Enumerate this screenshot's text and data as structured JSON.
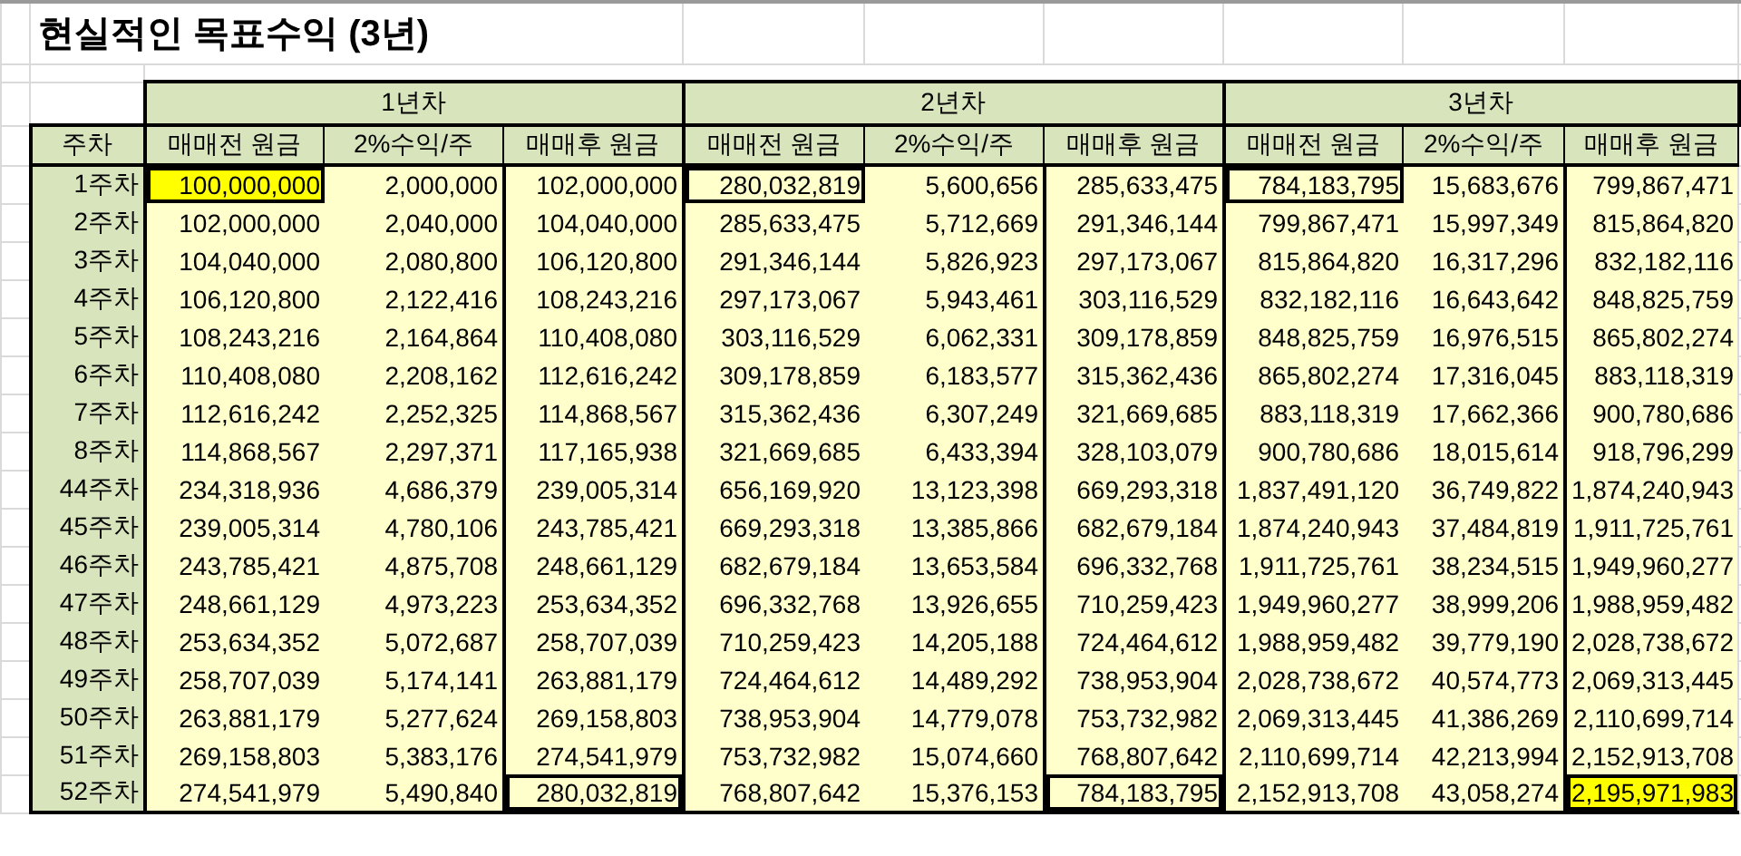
{
  "title": "현실적인 목표수익 (3년)",
  "year_groups": [
    "1년차",
    "2년차",
    "3년차"
  ],
  "columns": [
    "주차",
    "매매전 원금",
    "2%수익/주",
    "매매후 원금",
    "매매전 원금",
    "2%수익/주",
    "매매후 원금",
    "매매전 원금",
    "2%수익/주",
    "매매후 원금"
  ],
  "rows": [
    {
      "week": "1주차",
      "cells": [
        {
          "text": "100,000,000",
          "highlighted": true,
          "framed": true
        },
        {
          "text": "2,000,000",
          "highlighted": false,
          "framed": false
        },
        {
          "text": "102,000,000",
          "highlighted": false,
          "framed": false
        },
        {
          "text": "280,032,819",
          "highlighted": false,
          "framed": true
        },
        {
          "text": "5,600,656",
          "highlighted": false,
          "framed": false
        },
        {
          "text": "285,633,475",
          "highlighted": false,
          "framed": false
        },
        {
          "text": "784,183,795",
          "highlighted": false,
          "framed": true
        },
        {
          "text": "15,683,676",
          "highlighted": false,
          "framed": false
        },
        {
          "text": "799,867,471",
          "highlighted": false,
          "framed": false
        }
      ]
    },
    {
      "week": "2주차",
      "cells": [
        {
          "text": "102,000,000",
          "highlighted": false,
          "framed": false
        },
        {
          "text": "2,040,000",
          "highlighted": false,
          "framed": false
        },
        {
          "text": "104,040,000",
          "highlighted": false,
          "framed": false
        },
        {
          "text": "285,633,475",
          "highlighted": false,
          "framed": false
        },
        {
          "text": "5,712,669",
          "highlighted": false,
          "framed": false
        },
        {
          "text": "291,346,144",
          "highlighted": false,
          "framed": false
        },
        {
          "text": "799,867,471",
          "highlighted": false,
          "framed": false
        },
        {
          "text": "15,997,349",
          "highlighted": false,
          "framed": false
        },
        {
          "text": "815,864,820",
          "highlighted": false,
          "framed": false
        }
      ]
    },
    {
      "week": "3주차",
      "cells": [
        {
          "text": "104,040,000",
          "highlighted": false,
          "framed": false
        },
        {
          "text": "2,080,800",
          "highlighted": false,
          "framed": false
        },
        {
          "text": "106,120,800",
          "highlighted": false,
          "framed": false
        },
        {
          "text": "291,346,144",
          "highlighted": false,
          "framed": false
        },
        {
          "text": "5,826,923",
          "highlighted": false,
          "framed": false
        },
        {
          "text": "297,173,067",
          "highlighted": false,
          "framed": false
        },
        {
          "text": "815,864,820",
          "highlighted": false,
          "framed": false
        },
        {
          "text": "16,317,296",
          "highlighted": false,
          "framed": false
        },
        {
          "text": "832,182,116",
          "highlighted": false,
          "framed": false
        }
      ]
    },
    {
      "week": "4주차",
      "cells": [
        {
          "text": "106,120,800",
          "highlighted": false,
          "framed": false
        },
        {
          "text": "2,122,416",
          "highlighted": false,
          "framed": false
        },
        {
          "text": "108,243,216",
          "highlighted": false,
          "framed": false
        },
        {
          "text": "297,173,067",
          "highlighted": false,
          "framed": false
        },
        {
          "text": "5,943,461",
          "highlighted": false,
          "framed": false
        },
        {
          "text": "303,116,529",
          "highlighted": false,
          "framed": false
        },
        {
          "text": "832,182,116",
          "highlighted": false,
          "framed": false
        },
        {
          "text": "16,643,642",
          "highlighted": false,
          "framed": false
        },
        {
          "text": "848,825,759",
          "highlighted": false,
          "framed": false
        }
      ]
    },
    {
      "week": "5주차",
      "cells": [
        {
          "text": "108,243,216",
          "highlighted": false,
          "framed": false
        },
        {
          "text": "2,164,864",
          "highlighted": false,
          "framed": false
        },
        {
          "text": "110,408,080",
          "highlighted": false,
          "framed": false
        },
        {
          "text": "303,116,529",
          "highlighted": false,
          "framed": false
        },
        {
          "text": "6,062,331",
          "highlighted": false,
          "framed": false
        },
        {
          "text": "309,178,859",
          "highlighted": false,
          "framed": false
        },
        {
          "text": "848,825,759",
          "highlighted": false,
          "framed": false
        },
        {
          "text": "16,976,515",
          "highlighted": false,
          "framed": false
        },
        {
          "text": "865,802,274",
          "highlighted": false,
          "framed": false
        }
      ]
    },
    {
      "week": "6주차",
      "cells": [
        {
          "text": "110,408,080",
          "highlighted": false,
          "framed": false
        },
        {
          "text": "2,208,162",
          "highlighted": false,
          "framed": false
        },
        {
          "text": "112,616,242",
          "highlighted": false,
          "framed": false
        },
        {
          "text": "309,178,859",
          "highlighted": false,
          "framed": false
        },
        {
          "text": "6,183,577",
          "highlighted": false,
          "framed": false
        },
        {
          "text": "315,362,436",
          "highlighted": false,
          "framed": false
        },
        {
          "text": "865,802,274",
          "highlighted": false,
          "framed": false
        },
        {
          "text": "17,316,045",
          "highlighted": false,
          "framed": false
        },
        {
          "text": "883,118,319",
          "highlighted": false,
          "framed": false
        }
      ]
    },
    {
      "week": "7주차",
      "cells": [
        {
          "text": "112,616,242",
          "highlighted": false,
          "framed": false
        },
        {
          "text": "2,252,325",
          "highlighted": false,
          "framed": false
        },
        {
          "text": "114,868,567",
          "highlighted": false,
          "framed": false
        },
        {
          "text": "315,362,436",
          "highlighted": false,
          "framed": false
        },
        {
          "text": "6,307,249",
          "highlighted": false,
          "framed": false
        },
        {
          "text": "321,669,685",
          "highlighted": false,
          "framed": false
        },
        {
          "text": "883,118,319",
          "highlighted": false,
          "framed": false
        },
        {
          "text": "17,662,366",
          "highlighted": false,
          "framed": false
        },
        {
          "text": "900,780,686",
          "highlighted": false,
          "framed": false
        }
      ]
    },
    {
      "week": "8주차",
      "cells": [
        {
          "text": "114,868,567",
          "highlighted": false,
          "framed": false
        },
        {
          "text": "2,297,371",
          "highlighted": false,
          "framed": false
        },
        {
          "text": "117,165,938",
          "highlighted": false,
          "framed": false
        },
        {
          "text": "321,669,685",
          "highlighted": false,
          "framed": false
        },
        {
          "text": "6,433,394",
          "highlighted": false,
          "framed": false
        },
        {
          "text": "328,103,079",
          "highlighted": false,
          "framed": false
        },
        {
          "text": "900,780,686",
          "highlighted": false,
          "framed": false
        },
        {
          "text": "18,015,614",
          "highlighted": false,
          "framed": false
        },
        {
          "text": "918,796,299",
          "highlighted": false,
          "framed": false
        }
      ]
    },
    {
      "week": "44주차",
      "cells": [
        {
          "text": "234,318,936",
          "highlighted": false,
          "framed": false
        },
        {
          "text": "4,686,379",
          "highlighted": false,
          "framed": false
        },
        {
          "text": "239,005,314",
          "highlighted": false,
          "framed": false
        },
        {
          "text": "656,169,920",
          "highlighted": false,
          "framed": false
        },
        {
          "text": "13,123,398",
          "highlighted": false,
          "framed": false
        },
        {
          "text": "669,293,318",
          "highlighted": false,
          "framed": false
        },
        {
          "text": "1,837,491,120",
          "highlighted": false,
          "framed": false
        },
        {
          "text": "36,749,822",
          "highlighted": false,
          "framed": false
        },
        {
          "text": "1,874,240,943",
          "highlighted": false,
          "framed": false
        }
      ]
    },
    {
      "week": "45주차",
      "cells": [
        {
          "text": "239,005,314",
          "highlighted": false,
          "framed": false
        },
        {
          "text": "4,780,106",
          "highlighted": false,
          "framed": false
        },
        {
          "text": "243,785,421",
          "highlighted": false,
          "framed": false
        },
        {
          "text": "669,293,318",
          "highlighted": false,
          "framed": false
        },
        {
          "text": "13,385,866",
          "highlighted": false,
          "framed": false
        },
        {
          "text": "682,679,184",
          "highlighted": false,
          "framed": false
        },
        {
          "text": "1,874,240,943",
          "highlighted": false,
          "framed": false
        },
        {
          "text": "37,484,819",
          "highlighted": false,
          "framed": false
        },
        {
          "text": "1,911,725,761",
          "highlighted": false,
          "framed": false
        }
      ]
    },
    {
      "week": "46주차",
      "cells": [
        {
          "text": "243,785,421",
          "highlighted": false,
          "framed": false
        },
        {
          "text": "4,875,708",
          "highlighted": false,
          "framed": false
        },
        {
          "text": "248,661,129",
          "highlighted": false,
          "framed": false
        },
        {
          "text": "682,679,184",
          "highlighted": false,
          "framed": false
        },
        {
          "text": "13,653,584",
          "highlighted": false,
          "framed": false
        },
        {
          "text": "696,332,768",
          "highlighted": false,
          "framed": false
        },
        {
          "text": "1,911,725,761",
          "highlighted": false,
          "framed": false
        },
        {
          "text": "38,234,515",
          "highlighted": false,
          "framed": false
        },
        {
          "text": "1,949,960,277",
          "highlighted": false,
          "framed": false
        }
      ]
    },
    {
      "week": "47주차",
      "cells": [
        {
          "text": "248,661,129",
          "highlighted": false,
          "framed": false
        },
        {
          "text": "4,973,223",
          "highlighted": false,
          "framed": false
        },
        {
          "text": "253,634,352",
          "highlighted": false,
          "framed": false
        },
        {
          "text": "696,332,768",
          "highlighted": false,
          "framed": false
        },
        {
          "text": "13,926,655",
          "highlighted": false,
          "framed": false
        },
        {
          "text": "710,259,423",
          "highlighted": false,
          "framed": false
        },
        {
          "text": "1,949,960,277",
          "highlighted": false,
          "framed": false
        },
        {
          "text": "38,999,206",
          "highlighted": false,
          "framed": false
        },
        {
          "text": "1,988,959,482",
          "highlighted": false,
          "framed": false
        }
      ]
    },
    {
      "week": "48주차",
      "cells": [
        {
          "text": "253,634,352",
          "highlighted": false,
          "framed": false
        },
        {
          "text": "5,072,687",
          "highlighted": false,
          "framed": false
        },
        {
          "text": "258,707,039",
          "highlighted": false,
          "framed": false
        },
        {
          "text": "710,259,423",
          "highlighted": false,
          "framed": false
        },
        {
          "text": "14,205,188",
          "highlighted": false,
          "framed": false
        },
        {
          "text": "724,464,612",
          "highlighted": false,
          "framed": false
        },
        {
          "text": "1,988,959,482",
          "highlighted": false,
          "framed": false
        },
        {
          "text": "39,779,190",
          "highlighted": false,
          "framed": false
        },
        {
          "text": "2,028,738,672",
          "highlighted": false,
          "framed": false
        }
      ]
    },
    {
      "week": "49주차",
      "cells": [
        {
          "text": "258,707,039",
          "highlighted": false,
          "framed": false
        },
        {
          "text": "5,174,141",
          "highlighted": false,
          "framed": false
        },
        {
          "text": "263,881,179",
          "highlighted": false,
          "framed": false
        },
        {
          "text": "724,464,612",
          "highlighted": false,
          "framed": false
        },
        {
          "text": "14,489,292",
          "highlighted": false,
          "framed": false
        },
        {
          "text": "738,953,904",
          "highlighted": false,
          "framed": false
        },
        {
          "text": "2,028,738,672",
          "highlighted": false,
          "framed": false
        },
        {
          "text": "40,574,773",
          "highlighted": false,
          "framed": false
        },
        {
          "text": "2,069,313,445",
          "highlighted": false,
          "framed": false
        }
      ]
    },
    {
      "week": "50주차",
      "cells": [
        {
          "text": "263,881,179",
          "highlighted": false,
          "framed": false
        },
        {
          "text": "5,277,624",
          "highlighted": false,
          "framed": false
        },
        {
          "text": "269,158,803",
          "highlighted": false,
          "framed": false
        },
        {
          "text": "738,953,904",
          "highlighted": false,
          "framed": false
        },
        {
          "text": "14,779,078",
          "highlighted": false,
          "framed": false
        },
        {
          "text": "753,732,982",
          "highlighted": false,
          "framed": false
        },
        {
          "text": "2,069,313,445",
          "highlighted": false,
          "framed": false
        },
        {
          "text": "41,386,269",
          "highlighted": false,
          "framed": false
        },
        {
          "text": "2,110,699,714",
          "highlighted": false,
          "framed": false
        }
      ]
    },
    {
      "week": "51주차",
      "cells": [
        {
          "text": "269,158,803",
          "highlighted": false,
          "framed": false
        },
        {
          "text": "5,383,176",
          "highlighted": false,
          "framed": false
        },
        {
          "text": "274,541,979",
          "highlighted": false,
          "framed": false
        },
        {
          "text": "753,732,982",
          "highlighted": false,
          "framed": false
        },
        {
          "text": "15,074,660",
          "highlighted": false,
          "framed": false
        },
        {
          "text": "768,807,642",
          "highlighted": false,
          "framed": false
        },
        {
          "text": "2,110,699,714",
          "highlighted": false,
          "framed": false
        },
        {
          "text": "42,213,994",
          "highlighted": false,
          "framed": false
        },
        {
          "text": "2,152,913,708",
          "highlighted": false,
          "framed": false
        }
      ]
    },
    {
      "week": "52주차",
      "cells": [
        {
          "text": "274,541,979",
          "highlighted": false,
          "framed": false
        },
        {
          "text": "5,490,840",
          "highlighted": false,
          "framed": false
        },
        {
          "text": "280,032,819",
          "highlighted": false,
          "framed": true
        },
        {
          "text": "768,807,642",
          "highlighted": false,
          "framed": false
        },
        {
          "text": "15,376,153",
          "highlighted": false,
          "framed": false
        },
        {
          "text": "784,183,795",
          "highlighted": false,
          "framed": true
        },
        {
          "text": "2,152,913,708",
          "highlighted": false,
          "framed": false
        },
        {
          "text": "43,058,274",
          "highlighted": false,
          "framed": false
        },
        {
          "text": "2,195,971,983",
          "highlighted": true,
          "framed": true
        }
      ]
    }
  ]
}
